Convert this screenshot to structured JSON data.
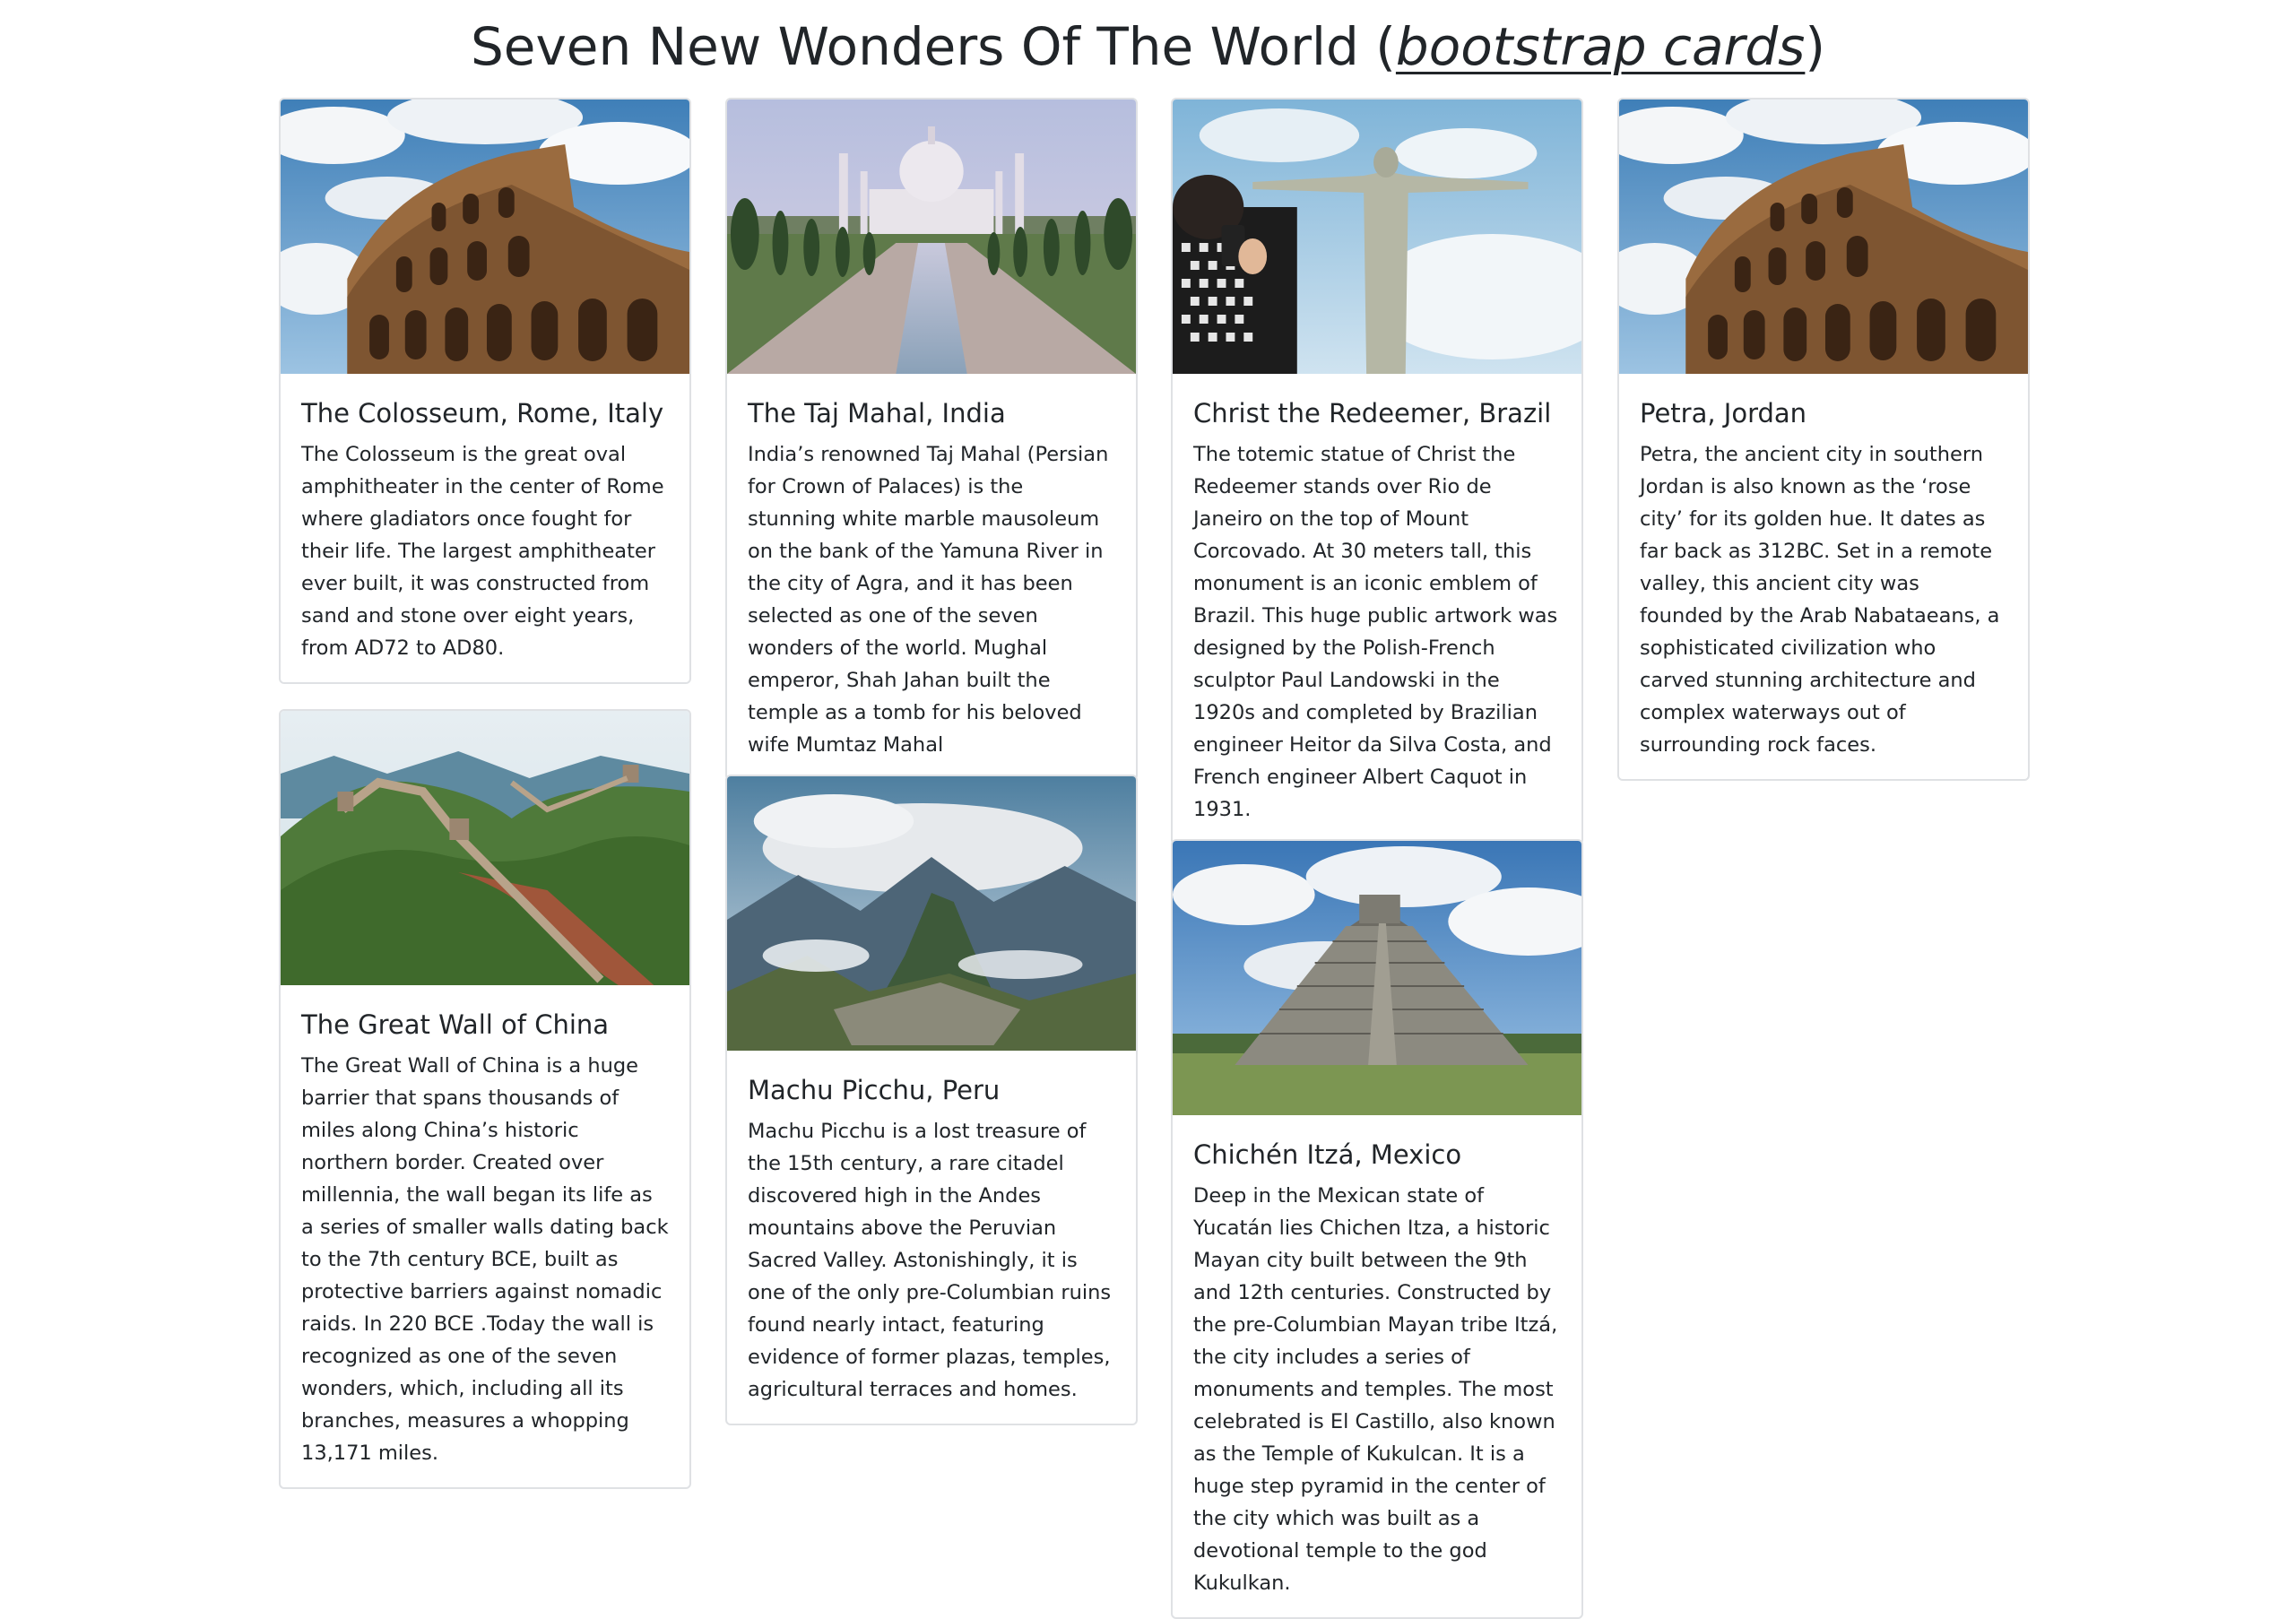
{
  "header": {
    "title_prefix": "Seven New Wonders Of The World (",
    "title_link": "bootstrap cards",
    "title_suffix": ")"
  },
  "cards": [
    {
      "title": "The Colosseum, Rome, Italy",
      "text": "The Colosseum is the great oval amphitheater in the center of Rome where gladiators once fought for their life. The largest amphitheater ever built, it was constructed from sand and stone over eight years, from AD72 to AD80."
    },
    {
      "title": "The Taj Mahal, India",
      "text": "India’s renowned Taj Mahal (Persian for Crown of Palaces) is the stunning white marble mausoleum on the bank of the Yamuna River in the city of Agra, and it has been selected as one of the seven wonders of the world. Mughal emperor, Shah Jahan built the temple as a tomb for his beloved wife Mumtaz Mahal"
    },
    {
      "title": "Christ the Redeemer, Brazil",
      "text": "The totemic statue of Christ the Redeemer stands over Rio de Janeiro on the top of Mount Corcovado. At 30 meters tall, this monument is an iconic emblem of Brazil. This huge public artwork was designed by the Polish-French sculptor Paul Landowski in the 1920s and completed by Brazilian engineer Heitor da Silva Costa, and French engineer Albert Caquot in 1931."
    },
    {
      "title": "Petra, Jordan",
      "text": "Petra, the ancient city in southern Jordan is also known as the ‘rose city’ for its golden hue. It dates as far back as 312BC. Set in a remote valley, this ancient city was founded by the Arab Nabataeans, a sophisticated civilization who carved stunning architecture and complex waterways out of surrounding rock faces."
    },
    {
      "title": "The Great Wall of China",
      "text": "The Great Wall of China is a huge barrier that spans thousands of miles along China’s historic northern border. Created over millennia, the wall began its life as a series of smaller walls dating back to the 7th century BCE, built as protective barriers against nomadic raids. In 220 BCE .Today the wall is recognized as one of the seven wonders, which, including all its branches, measures a whopping 13,171 miles."
    },
    {
      "title": "Machu Picchu, Peru",
      "text": "Machu Picchu is a lost treasure of the 15th century, a rare citadel discovered high in the Andes mountains above the Peruvian Sacred Valley. Astonishingly, it is one of the only pre-Columbian ruins found nearly intact, featuring evidence of former plazas, temples, agricultural terraces and homes."
    },
    {
      "title": "Chichén Itzá, Mexico",
      "text": "Deep in the Mexican state of Yucatán lies Chichen Itza, a historic Mayan city built between the 9th and 12th centuries. Constructed by the pre-Columbian Mayan tribe Itzá, the city includes a series of monuments and temples. The most celebrated is El Castillo, also known as the Temple of Kukulcan. It is a huge step pyramid in the center of the city which was built as a devotional temple to the god Kukulkan."
    }
  ]
}
